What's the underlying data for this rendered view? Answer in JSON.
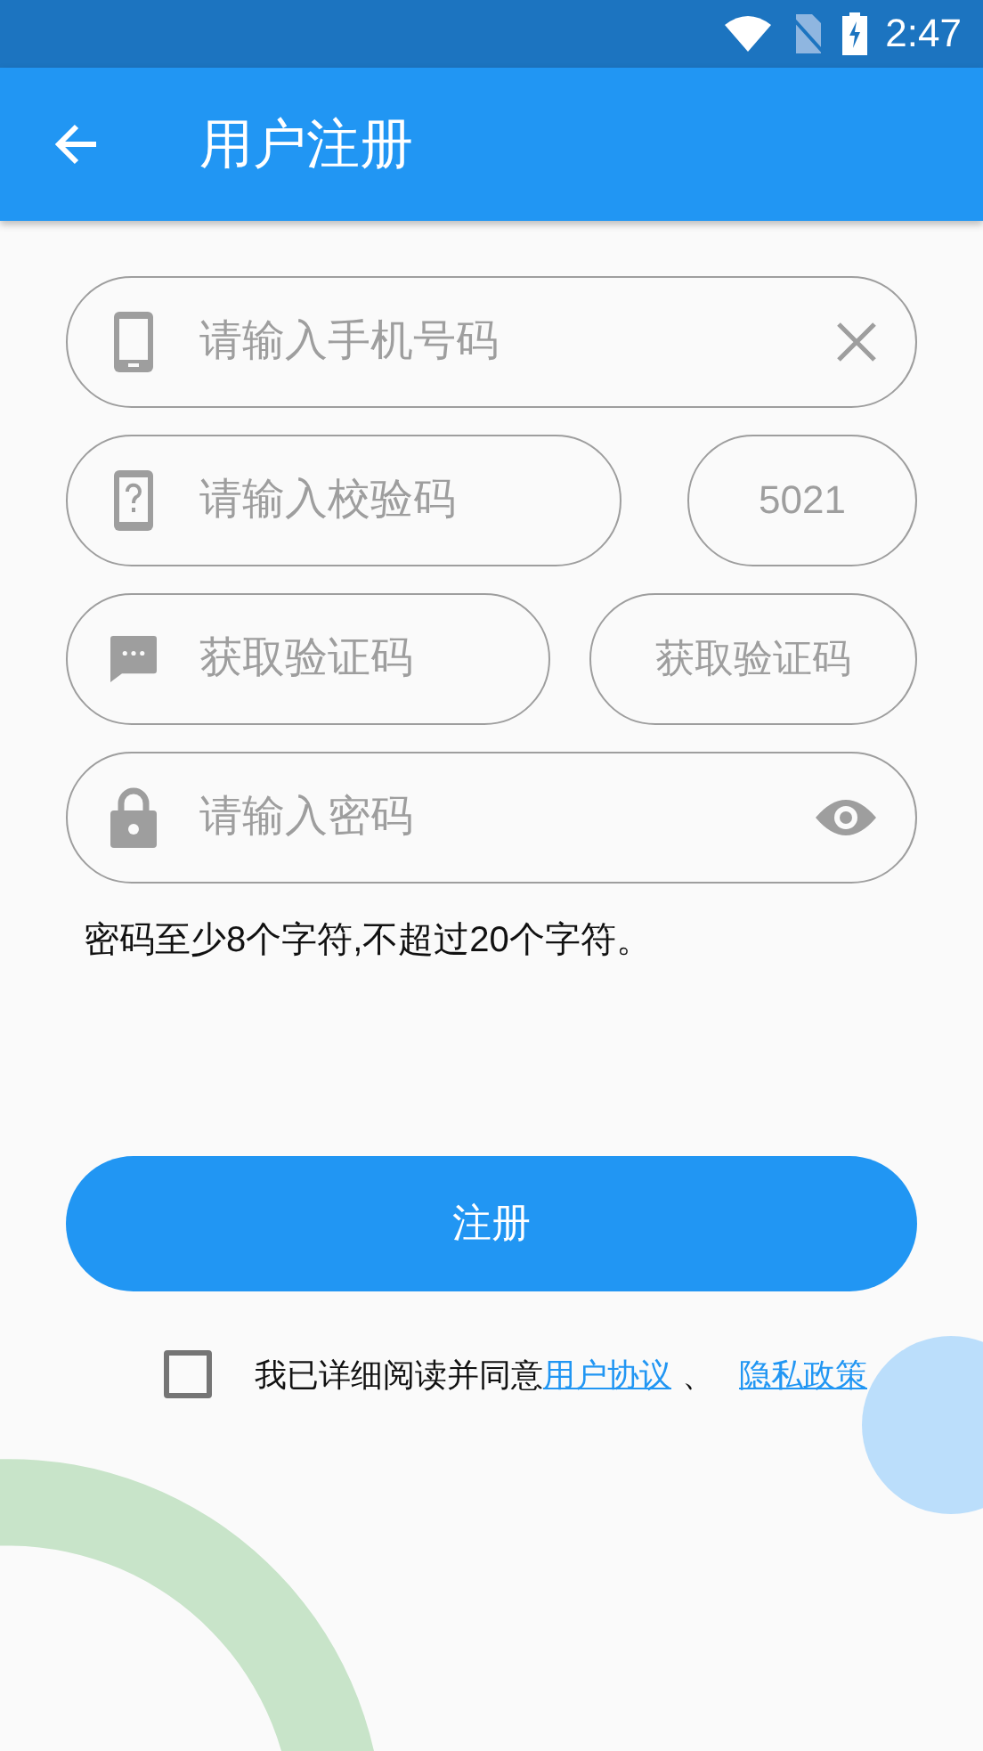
{
  "status_bar": {
    "time": "2:47"
  },
  "app_bar": {
    "title": "用户注册"
  },
  "fields": [
    {
      "kind": "phone",
      "placeholder": "请输入手机号码"
    },
    {
      "kind": "captcha",
      "placeholder": "请输入校验码",
      "captcha": "5021"
    },
    {
      "kind": "sms",
      "placeholder": "获取验证码",
      "button": "获取验证码"
    },
    {
      "kind": "password",
      "placeholder": "请输入密码"
    }
  ],
  "hint": "密码至少8个字符,不超过20个字符。",
  "register_button": "注册",
  "agreement": {
    "checked": false,
    "text": "我已详细阅读并同意",
    "links": [
      "用户协议",
      "隐私政策"
    ],
    "separator": "、"
  }
}
